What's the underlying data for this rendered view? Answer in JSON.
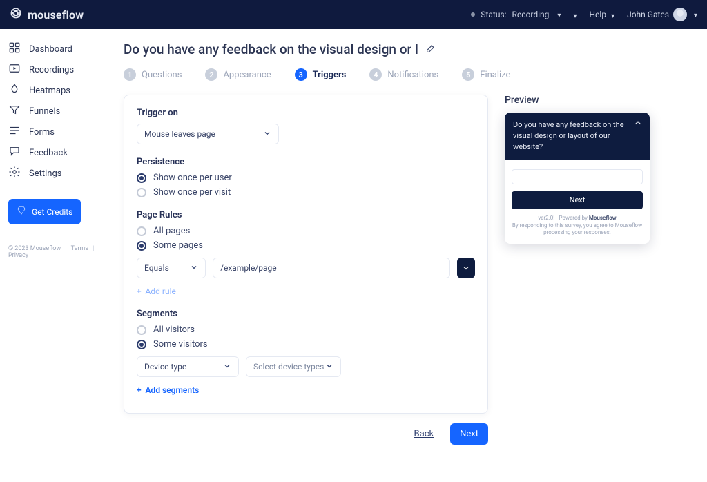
{
  "brand": {
    "name": "mouseflow"
  },
  "topbar": {
    "status_label": "Status:",
    "status_value": "Recording",
    "help_label": "Help",
    "user_name": "John Gates"
  },
  "sidebar": {
    "items": [
      {
        "label": "Dashboard"
      },
      {
        "label": "Recordings"
      },
      {
        "label": "Heatmaps"
      },
      {
        "label": "Funnels"
      },
      {
        "label": "Forms"
      },
      {
        "label": "Feedback"
      },
      {
        "label": "Settings"
      }
    ],
    "credits_btn": "Get Credits",
    "footer_copyright": "© 2023 Mouseflow",
    "footer_terms": "Terms",
    "footer_privacy": "Privacy"
  },
  "page": {
    "title": "Do you have any feedback on the visual design or l"
  },
  "steps": [
    {
      "num": "1",
      "label": "Questions",
      "active": false
    },
    {
      "num": "2",
      "label": "Appearance",
      "active": false
    },
    {
      "num": "3",
      "label": "Triggers",
      "active": true
    },
    {
      "num": "4",
      "label": "Notifications",
      "active": false
    },
    {
      "num": "5",
      "label": "Finalize",
      "active": false
    }
  ],
  "config": {
    "trigger_on": {
      "label": "Trigger on",
      "value": "Mouse leaves page"
    },
    "persistence": {
      "label": "Persistence",
      "options": [
        {
          "label": "Show once per user",
          "checked": true
        },
        {
          "label": "Show once per visit",
          "checked": false
        }
      ]
    },
    "page_rules": {
      "label": "Page Rules",
      "options": [
        {
          "label": "All pages",
          "checked": false
        },
        {
          "label": "Some pages",
          "checked": true
        }
      ],
      "operator": "Equals",
      "value": "/example/page",
      "add_label": "Add rule"
    },
    "segments": {
      "label": "Segments",
      "options": [
        {
          "label": "All visitors",
          "checked": false
        },
        {
          "label": "Some visitors",
          "checked": true
        }
      ],
      "type_value": "Device type",
      "select_placeholder": "Select device types",
      "add_label": "Add segments"
    }
  },
  "actions": {
    "back": "Back",
    "next": "Next"
  },
  "preview": {
    "title": "Preview",
    "question": "Do you have any feedback on the visual design or layout of our website?",
    "next": "Next",
    "foot_line1_a": "ver2.0! - Powered by ",
    "foot_line1_b": "Mouseflow",
    "foot_line2": "By responding to this survey, you agree to Mouseflow processing your responses."
  }
}
